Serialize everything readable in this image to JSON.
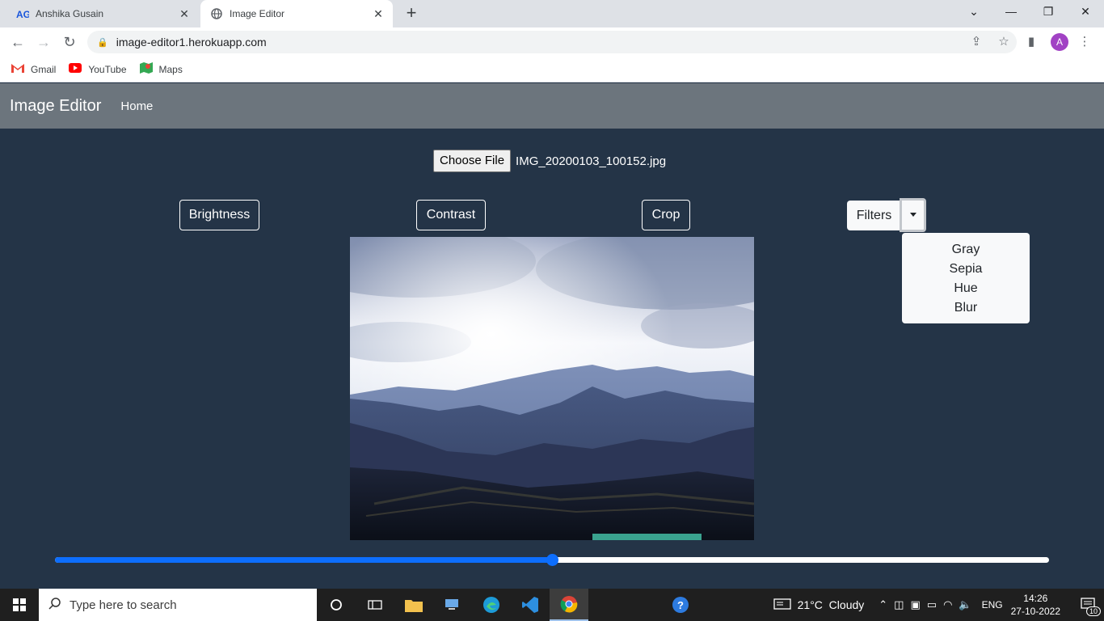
{
  "browser": {
    "tabs": [
      {
        "title": "Anshika Gusain",
        "icon": "ag-logo-icon",
        "active": false
      },
      {
        "title": "Image Editor",
        "icon": "globe-icon",
        "active": true
      }
    ],
    "url": "image-editor1.herokuapp.com",
    "avatar_letter": "A",
    "bookmarks": [
      {
        "label": "Gmail",
        "icon": "gmail-icon"
      },
      {
        "label": "YouTube",
        "icon": "youtube-icon"
      },
      {
        "label": "Maps",
        "icon": "maps-icon"
      }
    ]
  },
  "app": {
    "brand": "Image Editor",
    "nav": {
      "home": "Home"
    },
    "file": {
      "button": "Choose File",
      "name": "IMG_20200103_100152.jpg"
    },
    "buttons": {
      "brightness": "Brightness",
      "contrast": "Contrast",
      "crop": "Crop",
      "filters": "Filters"
    },
    "filter_options": [
      "Gray",
      "Sepia",
      "Hue",
      "Blur"
    ],
    "slider_value": 0.5,
    "colors": {
      "navbar": "#6c757d",
      "background": "#243447",
      "accent": "#0d6efd"
    }
  },
  "taskbar": {
    "search_placeholder": "Type here to search",
    "weather": "21°C  Cloudy",
    "language": "ENG",
    "time": "14:26",
    "date": "27-10-2022",
    "notifications": "10"
  }
}
